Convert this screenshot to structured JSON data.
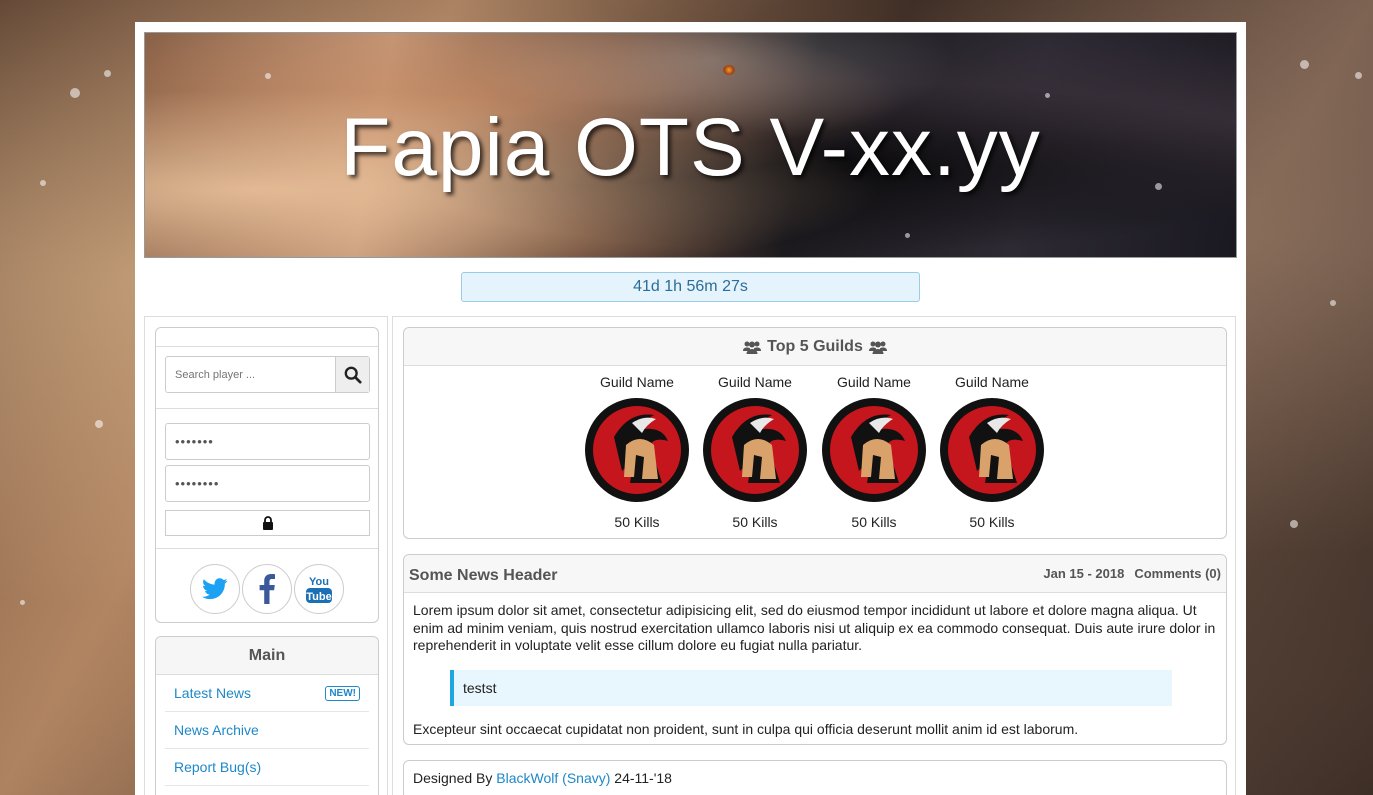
{
  "site": {
    "title": "Fapia OTS V-xx.yy",
    "countdown": "41d 1h 56m 27s"
  },
  "login": {
    "search_placeholder": "Search player ...",
    "account_masked": "•••••••",
    "password_masked": "••••••••"
  },
  "social": [
    {
      "name": "twitter",
      "color": "#1da1f2"
    },
    {
      "name": "facebook",
      "color": "#3b5998"
    },
    {
      "name": "youtube",
      "label": "You Tube",
      "color": "#1a6fb5"
    }
  ],
  "menu": {
    "title": "Main",
    "items": [
      {
        "label": "Latest News",
        "badge": "NEW!"
      },
      {
        "label": "News Archive"
      },
      {
        "label": "Report Bug(s)"
      }
    ]
  },
  "guilds": {
    "title": "Top 5 Guilds",
    "list": [
      {
        "name": "Guild Name",
        "kills": "50 Kills"
      },
      {
        "name": "Guild Name",
        "kills": "50 Kills"
      },
      {
        "name": "Guild Name",
        "kills": "50 Kills"
      },
      {
        "name": "Guild Name",
        "kills": "50 Kills"
      }
    ]
  },
  "news": {
    "title": "Some News Header",
    "date": "Jan 15 - 2018",
    "comments": "Comments (0)",
    "paragraph1": "Lorem ipsum dolor sit amet, consectetur adipisicing elit, sed do eiusmod tempor incididunt ut labore et dolore magna aliqua. Ut enim ad minim veniam, quis nostrud exercitation ullamco laboris nisi ut aliquip ex ea commodo consequat. Duis aute irure dolor in reprehenderit in voluptate velit esse cillum dolore eu fugiat nulla pariatur.",
    "quote": "testst",
    "paragraph2": "Excepteur sint occaecat cupidatat non proident, sunt in culpa qui officia deserunt mollit anim id est laborum."
  },
  "footer": {
    "prefix": "Designed By",
    "author": "BlackWolf (Snavy)",
    "date": "24-11-'18"
  },
  "colors": {
    "link": "#1e88c8",
    "accent": "#1ea6e0",
    "countdown_bg": "#e4f3fc"
  }
}
